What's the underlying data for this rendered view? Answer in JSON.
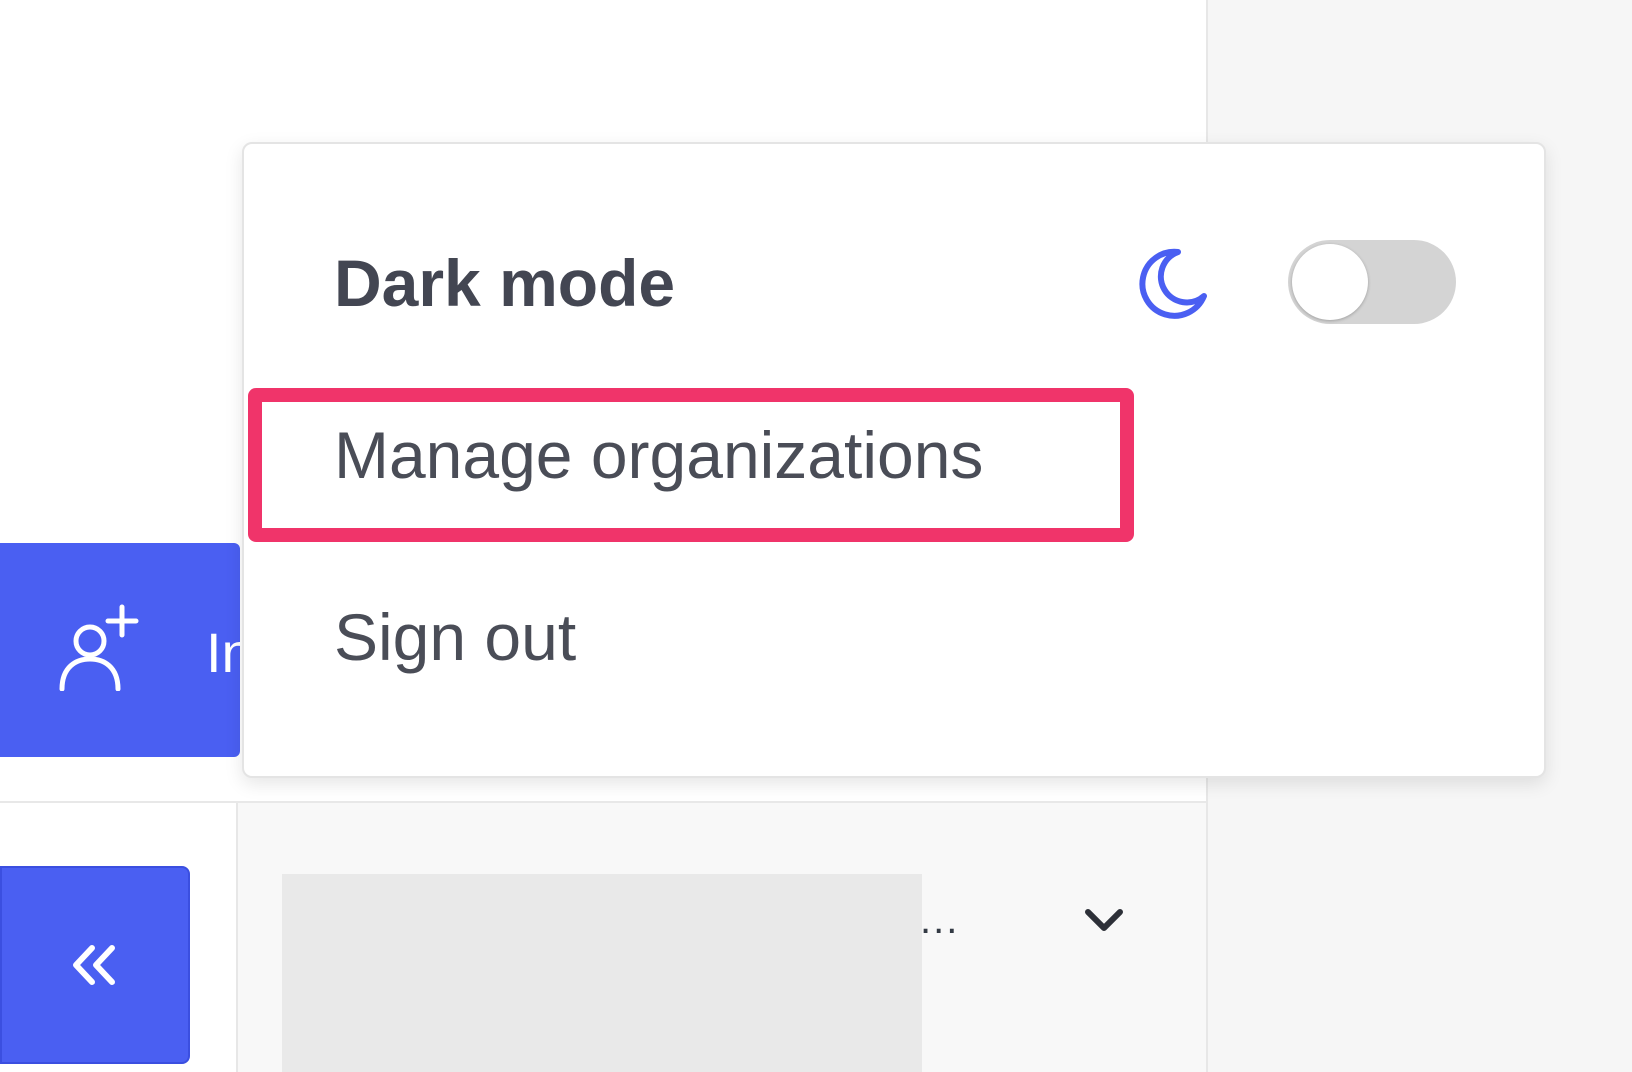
{
  "invite_button": {
    "label": "In",
    "icon": "person-add-icon"
  },
  "collapse_button": {
    "icon": "double-chevron-left-icon"
  },
  "select_row": {
    "ellipsis": "...",
    "icon": "chevron-down-icon"
  },
  "menu": {
    "dark_mode": {
      "label": "Dark mode",
      "icon": "moon-icon",
      "enabled": false
    },
    "manage_organizations": {
      "label": "Manage organizations",
      "highlighted": true
    },
    "sign_out": {
      "label": "Sign out"
    }
  },
  "colors": {
    "accent": "#4a5ff2",
    "highlight": "#f0346a",
    "toggle_off": "#d4d4d4"
  }
}
